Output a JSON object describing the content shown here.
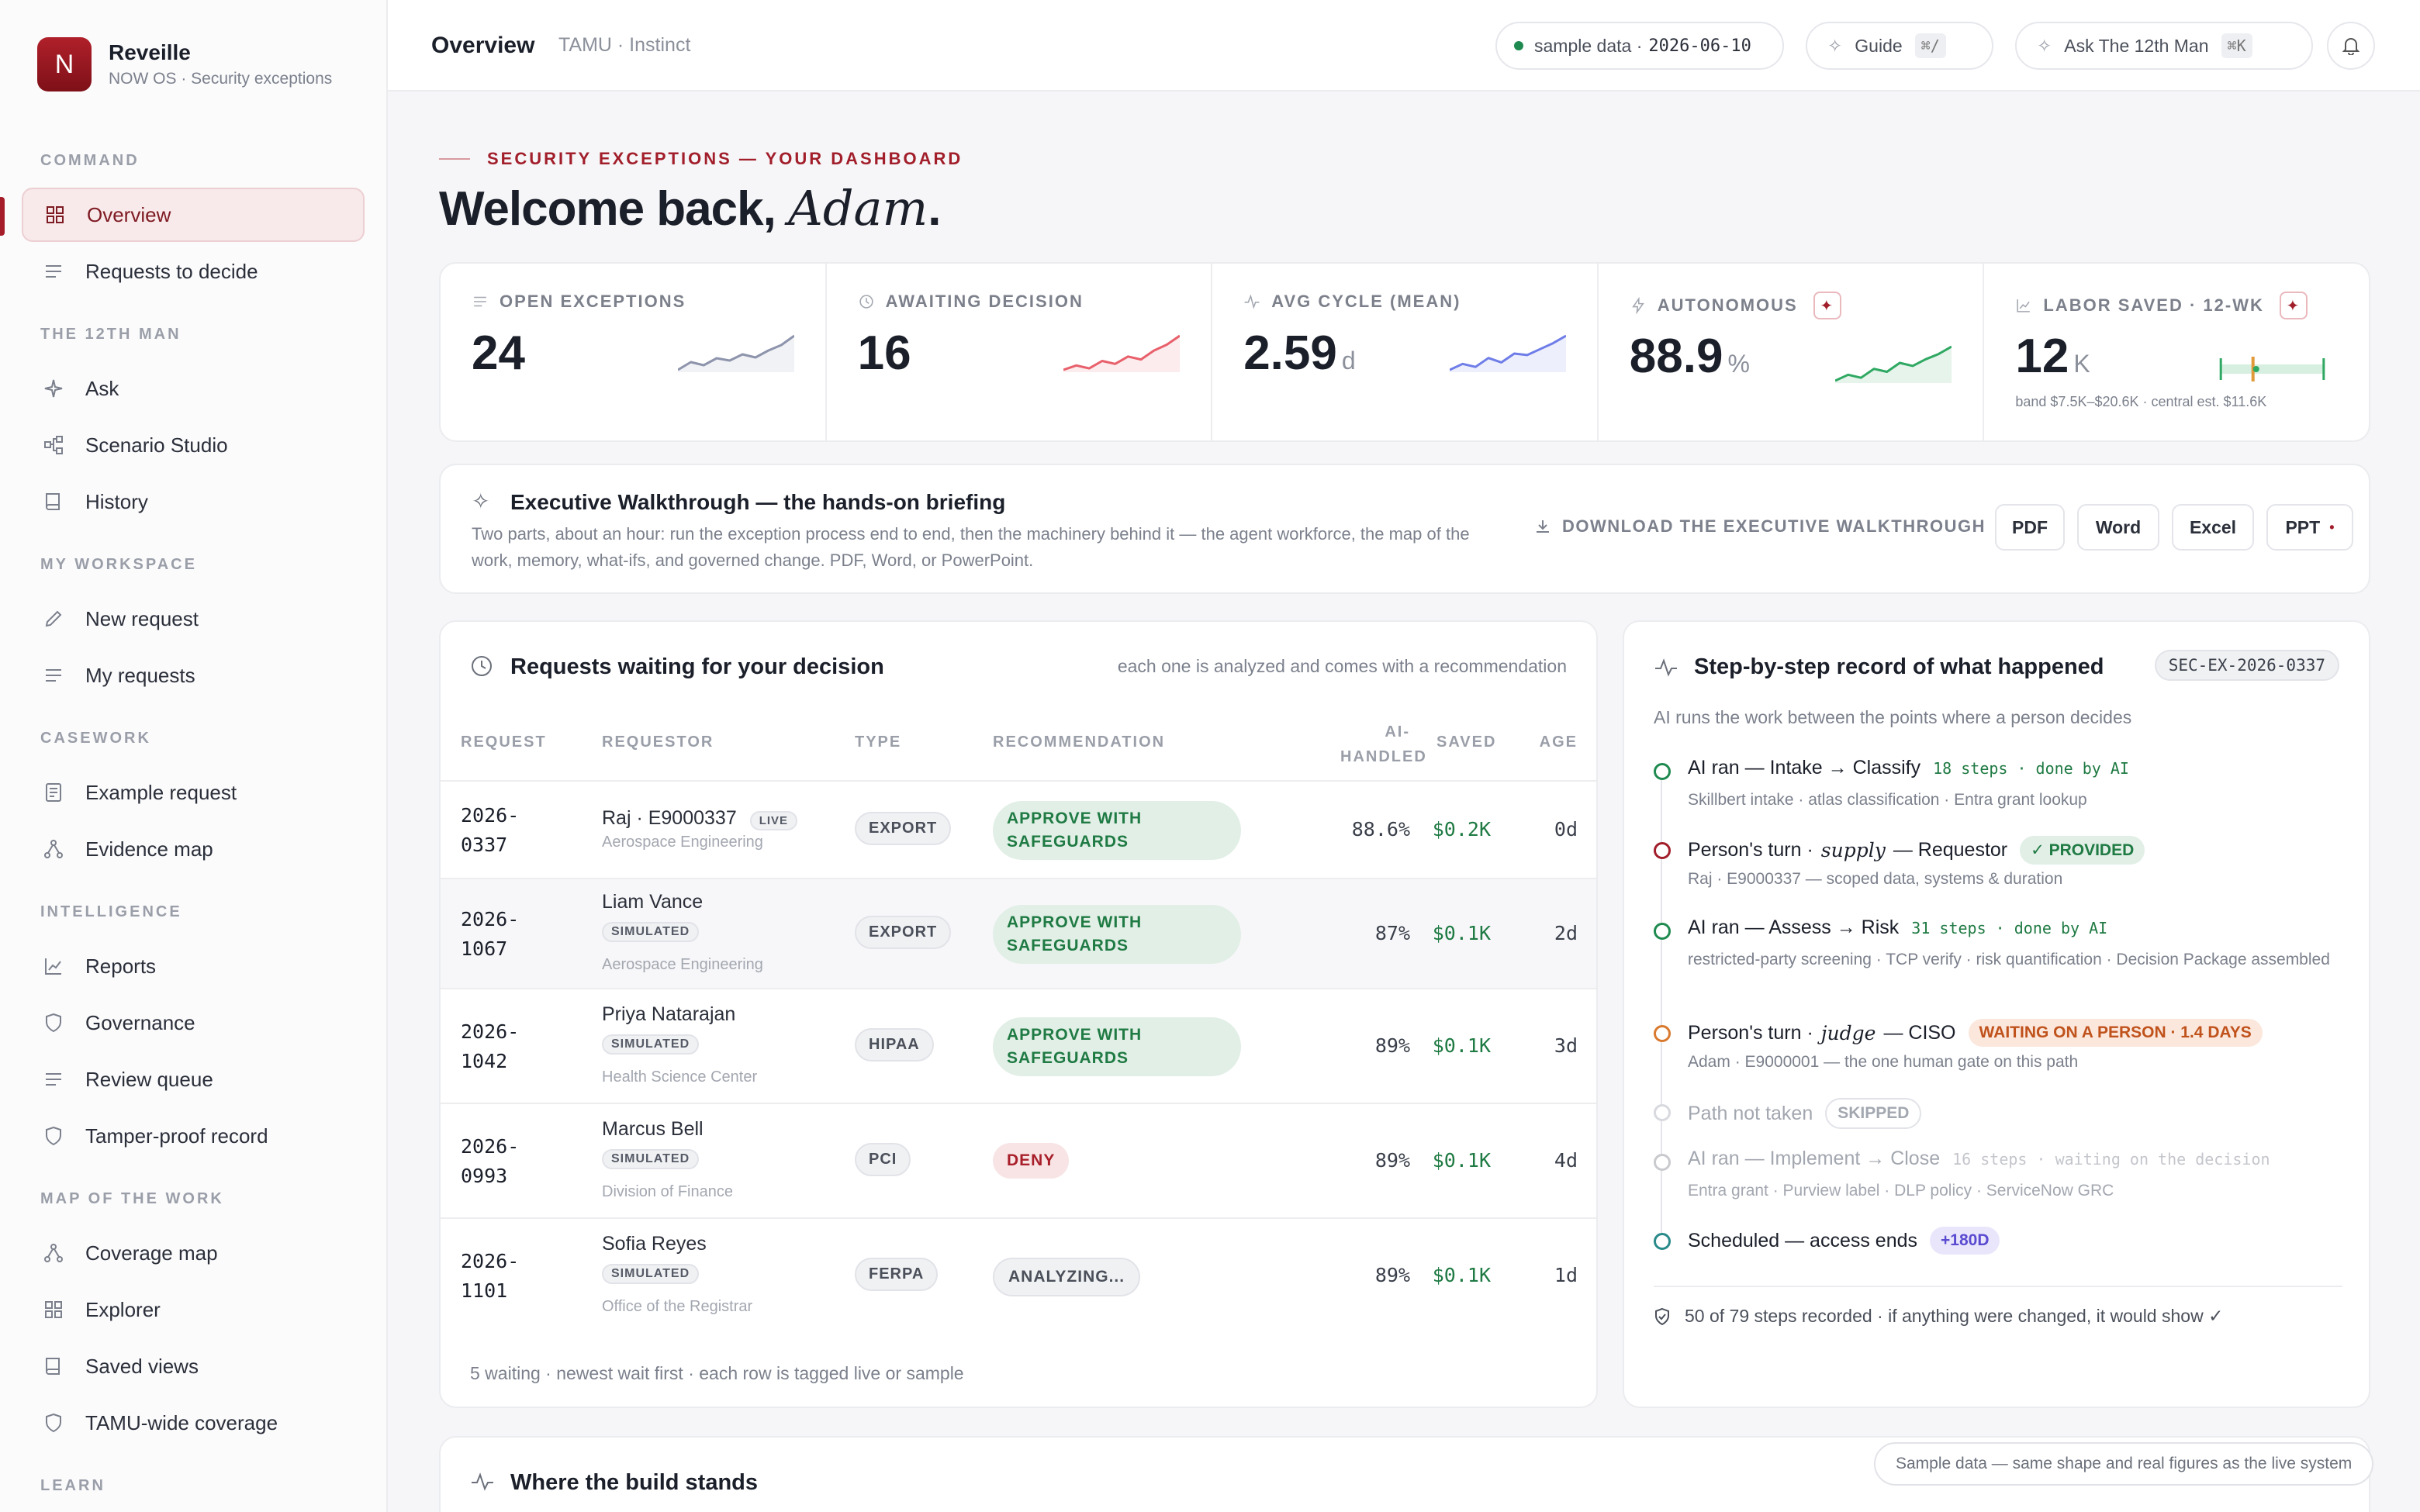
{
  "brand": {
    "logo_letter": "N",
    "name": "Reveille",
    "subtitle": "NOW OS · Security exceptions"
  },
  "sidebar": {
    "sections": [
      {
        "label": "COMMAND",
        "items": [
          {
            "label": "Overview",
            "icon": "grid-icon",
            "active": true
          },
          {
            "label": "Requests to decide",
            "icon": "list-icon"
          }
        ]
      },
      {
        "label": "THE 12TH MAN",
        "items": [
          {
            "label": "Ask",
            "icon": "sparkle-icon"
          },
          {
            "label": "Scenario Studio",
            "icon": "nodes-icon"
          },
          {
            "label": "History",
            "icon": "book-icon"
          }
        ]
      },
      {
        "label": "MY WORKSPACE",
        "items": [
          {
            "label": "New request",
            "icon": "pencil-icon"
          },
          {
            "label": "My requests",
            "icon": "list-icon"
          }
        ]
      },
      {
        "label": "CASEWORK",
        "items": [
          {
            "label": "Example request",
            "icon": "document-icon"
          },
          {
            "label": "Evidence map",
            "icon": "network-icon"
          }
        ]
      },
      {
        "label": "INTELLIGENCE",
        "items": [
          {
            "label": "Reports",
            "icon": "chart-icon"
          },
          {
            "label": "Governance",
            "icon": "shield-icon"
          },
          {
            "label": "Review queue",
            "icon": "list-icon"
          },
          {
            "label": "Tamper-proof record",
            "icon": "shield-icon"
          }
        ]
      },
      {
        "label": "MAP OF THE WORK",
        "items": [
          {
            "label": "Coverage map",
            "icon": "network-icon"
          },
          {
            "label": "Explorer",
            "icon": "grid-icon"
          },
          {
            "label": "Saved views",
            "icon": "book-icon"
          },
          {
            "label": "TAMU-wide coverage",
            "icon": "shield-icon"
          }
        ]
      },
      {
        "label": "LEARN",
        "items": []
      }
    ]
  },
  "topbar": {
    "title": "Overview",
    "breadcrumb": "TAMU · Instinct",
    "data_label": "sample data ·",
    "data_date": "2026-06-10",
    "guide_label": "Guide",
    "guide_shortcut": "⌘/",
    "ask_label": "Ask The 12th Man",
    "ask_shortcut": "⌘K"
  },
  "hero": {
    "eyebrow": "SECURITY EXCEPTIONS — YOUR DASHBOARD",
    "greeting": "Welcome back,",
    "name": "Adam",
    "period": "."
  },
  "kpis": [
    {
      "label": "OPEN EXCEPTIONS",
      "value": "24",
      "unit": "",
      "icon": "list-icon",
      "spark_color": "#8d94ac",
      "spark": [
        3,
        4,
        3.6,
        4.5,
        4.2,
        5,
        4.6,
        5.5,
        6.2,
        7.4
      ]
    },
    {
      "label": "AWAITING DECISION",
      "value": "16",
      "unit": "",
      "icon": "clock-icon",
      "spark_color": "#e8606b",
      "spark": [
        3,
        3.6,
        3.2,
        4.2,
        3.8,
        4.8,
        4.4,
        5.6,
        6.4,
        7.6
      ]
    },
    {
      "label": "AVG CYCLE (MEAN)",
      "value": "2.59",
      "unit": "d",
      "icon": "pulse-icon",
      "spark_color": "#6f7de8",
      "spark": [
        3,
        3.8,
        3.4,
        4.6,
        4,
        5.2,
        5,
        5.8,
        6.6,
        7.6
      ]
    },
    {
      "label": "AUTONOMOUS",
      "value": "88.9",
      "unit": "%",
      "icon": "bolt-icon",
      "spark_color": "#2fa862",
      "spark": [
        3,
        3.8,
        3.4,
        4.6,
        4.2,
        5.4,
        5,
        5.9,
        6.6,
        7.6
      ],
      "badge": "✦"
    },
    {
      "label": "LABOR SAVED · 12-WK",
      "value": "12",
      "unit": "K",
      "icon": "chart-icon",
      "badge": "✦",
      "band_text": "band $7.5K–$20.6K · central est. $11.6K",
      "band_low": 7.5,
      "band_high": 20.6,
      "central": 11.6,
      "value_k": 12
    }
  ],
  "walkthrough": {
    "title": "Executive Walkthrough — the hands-on briefing",
    "description": "Two parts, about an hour: run the exception process end to end, then the machinery behind it — the agent workforce, the map of the work, memory, what-ifs, and governed change. PDF, Word, or PowerPoint.",
    "download_label": "DOWNLOAD THE EXECUTIVE WALKTHROUGH",
    "formats": [
      "PDF",
      "Word",
      "Excel",
      "PPT"
    ]
  },
  "requests": {
    "title": "Requests waiting for your decision",
    "hint": "each one is analyzed and comes with a recommendation",
    "columns": [
      "REQUEST",
      "REQUESTOR",
      "TYPE",
      "RECOMMENDATION",
      "AI-HANDLED",
      "SAVED",
      "AGE"
    ],
    "rows": [
      {
        "id_a": "2026-",
        "id_b": "0337",
        "name": "Raj · E9000337",
        "tag": "LIVE",
        "org": "Aerospace Engineering",
        "type": "EXPORT",
        "rec": "APPROVE WITH SAFEGUARDS",
        "rec_kind": "approve",
        "ai": "88.6%",
        "saved": "$0.2K",
        "age": "0d"
      },
      {
        "id_a": "2026-",
        "id_b": "1067",
        "name": "Liam Vance",
        "tag": "SIMULATED",
        "org": "Aerospace Engineering",
        "type": "EXPORT",
        "rec": "APPROVE WITH SAFEGUARDS",
        "rec_kind": "approve",
        "ai": "87%",
        "saved": "$0.1K",
        "age": "2d"
      },
      {
        "id_a": "2026-",
        "id_b": "1042",
        "name": "Priya Natarajan",
        "tag": "SIMULATED",
        "org": "Health Science Center",
        "type": "HIPAA",
        "rec": "APPROVE WITH SAFEGUARDS",
        "rec_kind": "approve",
        "ai": "89%",
        "saved": "$0.1K",
        "age": "3d"
      },
      {
        "id_a": "2026-",
        "id_b": "0993",
        "name": "Marcus Bell",
        "tag": "SIMULATED",
        "org": "Division of Finance",
        "type": "PCI",
        "rec": "DENY",
        "rec_kind": "deny",
        "ai": "89%",
        "saved": "$0.1K",
        "age": "4d"
      },
      {
        "id_a": "2026-",
        "id_b": "1101",
        "name": "Sofia Reyes",
        "tag": "SIMULATED",
        "org": "Office of the Registrar",
        "type": "FERPA",
        "rec": "ANALYZING...",
        "rec_kind": "analyzing",
        "ai": "89%",
        "saved": "$0.1K",
        "age": "1d"
      }
    ],
    "footer": "5 waiting · newest wait first · each row is tagged live or sample"
  },
  "record": {
    "title": "Step-by-step record of what happened",
    "case_id": "SEC-EX-2026-0337",
    "subtitle": "AI runs the work between the points where a person decides",
    "steps": [
      {
        "pre": "AI ran — Intake → Classify",
        "ai_tag": "18 steps · done by AI",
        "sub": "Skillbert intake · atlas classification · Entra grant lookup",
        "dot": "#1f8a50"
      },
      {
        "pre": "Person's turn ·",
        "script": "supply",
        "post": "— Requestor",
        "pill": "✓ PROVIDED",
        "pill_bg": "#e1efe6",
        "pill_fg": "#1f7a43",
        "sub": "Raj · E9000337 — scoped data, systems & duration",
        "dot": "#a11e2a"
      },
      {
        "pre": "AI ran — Assess → Risk",
        "ai_tag": "31 steps · done by AI",
        "sub": "restricted-party screening · TCP verify · risk quantification · Decision Package assembled",
        "dot": "#1f8a50"
      },
      {
        "pre": "Person's turn ·",
        "script": "judge",
        "post": "— CISO",
        "pill": "WAITING ON A PERSON · 1.4 DAYS",
        "pill_bg": "#fbe7dc",
        "pill_fg": "#c0521c",
        "sub": "Adam · E9000001 — the one human gate on this path",
        "dot": "#d9792e"
      },
      {
        "pre": "Path not taken",
        "pill": "SKIPPED",
        "pill_bg": "#ffffff",
        "pill_fg": "#a3a7b0",
        "muted": true,
        "dot": "#d8d9de"
      },
      {
        "pre": "AI ran — Implement → Close",
        "ai_tag": "16 steps · waiting on the decision",
        "ai_muted": true,
        "sub": "Entra grant · Purview label · DLP policy · ServiceNow GRC",
        "muted": true,
        "dot": "#c9cace"
      },
      {
        "pre": "Scheduled — access ends",
        "pill": "+180D",
        "pill_bg": "#e9e6fb",
        "pill_fg": "#5a4bd0",
        "dot": "#2a8a8a"
      }
    ],
    "footer": "50 of 79 steps recorded · if anything were changed, it would show ✓"
  },
  "build": {
    "title": "Where the build stands"
  },
  "toast": "Sample data — same shape and real figures as the live system",
  "colors": {
    "brand": "#a11e2a",
    "green": "#1f7a43",
    "orange": "#c0521c"
  }
}
